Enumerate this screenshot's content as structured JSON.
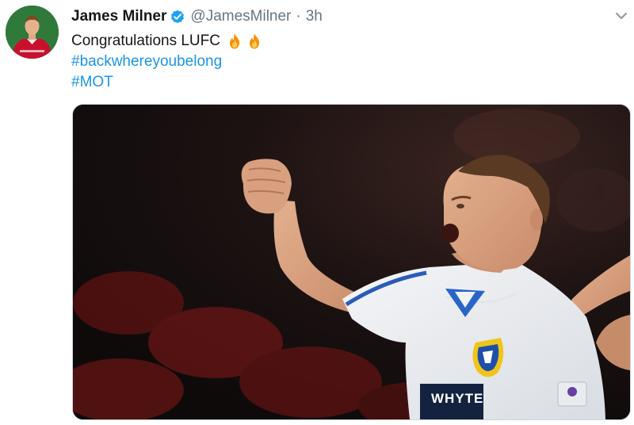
{
  "tweet": {
    "display_name": "James Milner",
    "handle": "@JamesMilner",
    "separator": "·",
    "timestamp": "3h",
    "verified": true,
    "text_line1": "Congratulations LUFC",
    "emoji": [
      "fire",
      "fire"
    ],
    "hashtags": [
      "#backwhereyoubelong",
      "#MOT"
    ]
  },
  "media": {
    "shirt_sponsor": "WHYTE"
  },
  "colors": {
    "link": "#1b95e0",
    "verified": "#1da1f2",
    "text": "#14171a",
    "muted": "#657786"
  },
  "icons": {
    "verified": "verified-badge-icon",
    "menu": "chevron-down-icon",
    "emoji": "fire-emoji-icon"
  }
}
